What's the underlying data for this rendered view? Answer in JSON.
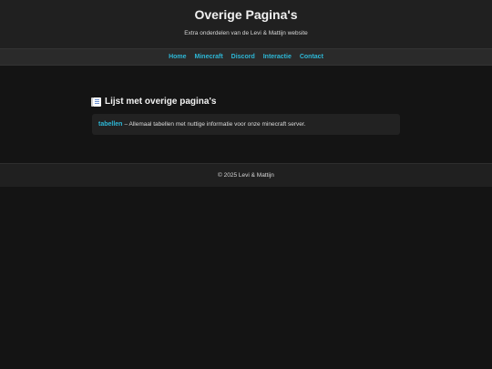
{
  "header": {
    "title": "Overige Pagina's",
    "subtitle": "Extra onderdelen van de Levi & Mattijn website"
  },
  "nav": {
    "items": [
      "Home",
      "Minecraft",
      "Discord",
      "Interactie",
      "Contact"
    ]
  },
  "main": {
    "heading": "Lijst met overige pagina's",
    "heading_icon": "page-with-curl-icon",
    "entries": [
      {
        "link": "tabellen",
        "description": "– Allemaal tabellen met nuttige informatie voor onze minecraft server."
      }
    ]
  },
  "footer": {
    "text": "© 2025 Levi & Mattijn"
  },
  "colors": {
    "accent": "#2db7d6",
    "background": "#141414",
    "panel": "#202020"
  }
}
